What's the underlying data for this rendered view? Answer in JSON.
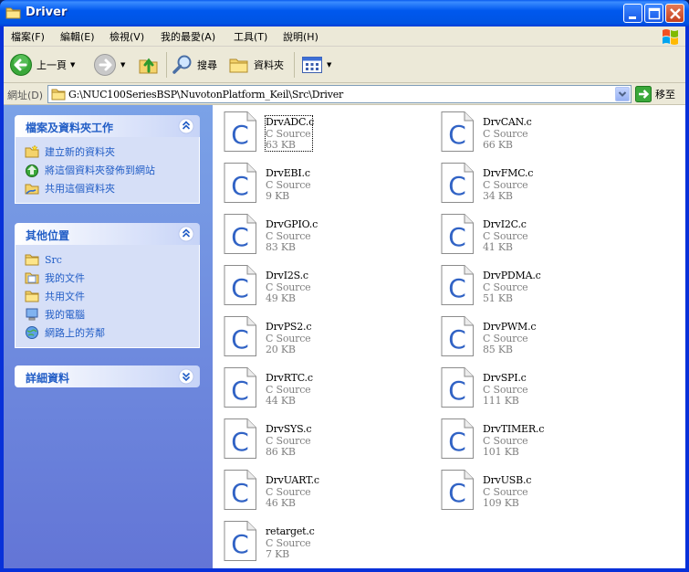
{
  "window": {
    "title": "Driver"
  },
  "menu": [
    "檔案(F)",
    "編輯(E)",
    "檢視(V)",
    "我的最愛(A)",
    "工具(T)",
    "說明(H)"
  ],
  "toolbar": {
    "back": "上一頁",
    "search": "搜尋",
    "folders": "資料夾"
  },
  "address": {
    "label": "網址(D)",
    "path": "G:\\NUC100SeriesBSP\\NuvotonPlatform_Keil\\Src\\Driver",
    "go": "移至"
  },
  "tasks": {
    "file_tasks": {
      "title": "檔案及資料夾工作",
      "items": [
        "建立新的資料夾",
        "將這個資料夾發佈到網站",
        "共用這個資料夾"
      ]
    },
    "other_places": {
      "title": "其他位置",
      "items": [
        "Src",
        "我的文件",
        "共用文件",
        "我的電腦",
        "網路上的芳鄰"
      ]
    },
    "details": {
      "title": "詳細資料"
    }
  },
  "files": [
    {
      "name": "DrvADC.c",
      "type": "C Source",
      "size": "63 KB"
    },
    {
      "name": "DrvCAN.c",
      "type": "C Source",
      "size": "66 KB"
    },
    {
      "name": "DrvEBI.c",
      "type": "C Source",
      "size": "9 KB"
    },
    {
      "name": "DrvFMC.c",
      "type": "C Source",
      "size": "34 KB"
    },
    {
      "name": "DrvGPIO.c",
      "type": "C Source",
      "size": "83 KB"
    },
    {
      "name": "DrvI2C.c",
      "type": "C Source",
      "size": "41 KB"
    },
    {
      "name": "DrvI2S.c",
      "type": "C Source",
      "size": "49 KB"
    },
    {
      "name": "DrvPDMA.c",
      "type": "C Source",
      "size": "51 KB"
    },
    {
      "name": "DrvPS2.c",
      "type": "C Source",
      "size": "20 KB"
    },
    {
      "name": "DrvPWM.c",
      "type": "C Source",
      "size": "85 KB"
    },
    {
      "name": "DrvRTC.c",
      "type": "C Source",
      "size": "44 KB"
    },
    {
      "name": "DrvSPI.c",
      "type": "C Source",
      "size": "111 KB"
    },
    {
      "name": "DrvSYS.c",
      "type": "C Source",
      "size": "86 KB"
    },
    {
      "name": "DrvTIMER.c",
      "type": "C Source",
      "size": "101 KB"
    },
    {
      "name": "DrvUART.c",
      "type": "C Source",
      "size": "46 KB"
    },
    {
      "name": "DrvUSB.c",
      "type": "C Source",
      "size": "109 KB"
    },
    {
      "name": "retarget.c",
      "type": "C Source",
      "size": "7 KB"
    }
  ],
  "colors": {
    "title_blue": "#0054e3",
    "link_blue": "#215dc6",
    "c_icon_blue": "#3163c5",
    "task_pane_top": "#7ba2e7",
    "task_pane_bottom": "#6375d6"
  }
}
